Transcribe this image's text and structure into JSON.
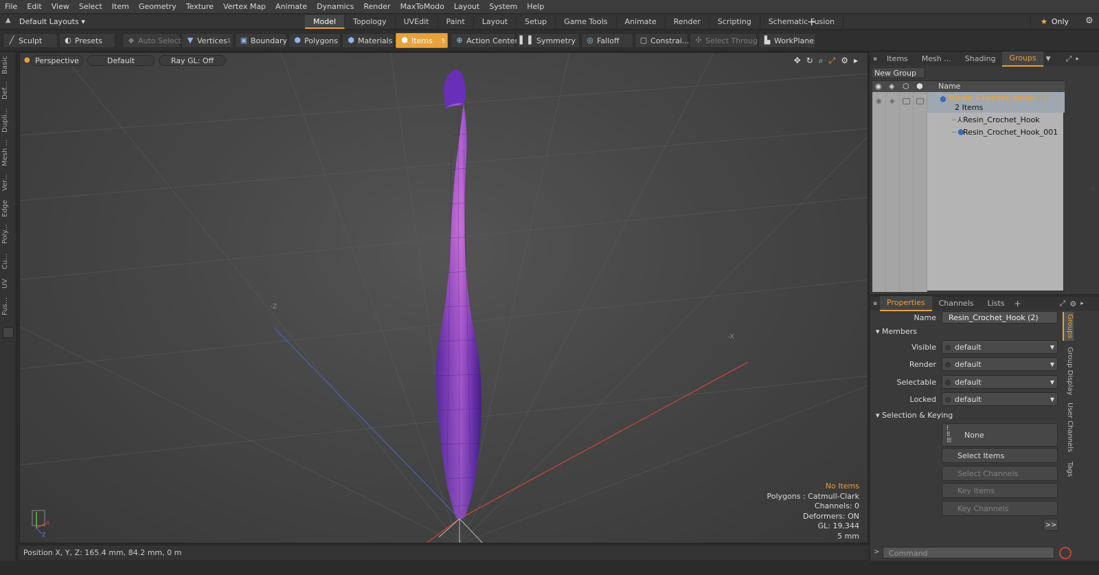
{
  "menubar": [
    "File",
    "Edit",
    "View",
    "Select",
    "Item",
    "Geometry",
    "Texture",
    "Vertex Map",
    "Animate",
    "Dynamics",
    "Render",
    "MaxToModo",
    "Layout",
    "System",
    "Help"
  ],
  "layout": {
    "selector": "Default Layouts",
    "tabs": [
      "Model",
      "Topology",
      "UVEdit",
      "Paint",
      "Layout",
      "Setup",
      "Game Tools",
      "Animate",
      "Render",
      "Scripting",
      "Schematic Fusion"
    ],
    "active_tab": "Model",
    "only_label": "Only"
  },
  "toolbar": {
    "sculpt": "Sculpt",
    "presets": "Presets",
    "auto_select": "Auto Select",
    "vertices": "Vertices",
    "vertices_count": "1",
    "boundary": "Boundary",
    "polygons": "Polygons",
    "materials": "Materials",
    "items": "Items",
    "items_count": "5",
    "action_center": "Action Center",
    "symmetry": "Symmetry",
    "falloff": "Falloff",
    "constrain": "Constrai...",
    "select_through": "Select Through",
    "workplane": "WorkPlane"
  },
  "left_tabs": [
    "Basic",
    "Def...",
    "Dupli...",
    "Mesh ...",
    "Ver...",
    "Edge",
    "Poly...",
    "Cu...",
    "UV",
    "Fus..."
  ],
  "viewport": {
    "view": "Perspective",
    "shading": "Default",
    "raygl": "Ray GL: Off",
    "axis_z_label": "-Z",
    "axis_x_label": "-X",
    "info": {
      "selection": "No Items",
      "polygons": "Polygons : Catmull-Clark",
      "channels": "Channels: 0",
      "deformers": "Deformers: ON",
      "gl": "GL: 19,344",
      "scale": "5 mm"
    }
  },
  "status": {
    "position": "Position X, Y, Z:  165.4 mm, 84.2 mm, 0 m"
  },
  "groups_panel": {
    "tabs": [
      "Items",
      "Mesh ...",
      "Shading",
      "Groups"
    ],
    "active_tab": "Groups",
    "new_group": "New Group",
    "col_name": "Name",
    "group_name": "Resin_Crochet_Hook",
    "group_suffix": "(2) : ...",
    "group_count": "2 Items",
    "children": [
      "Resin_Crochet_Hook",
      "Resin_Crochet_Hook_001"
    ]
  },
  "properties": {
    "tabs": [
      "Properties",
      "Channels",
      "Lists"
    ],
    "name_label": "Name",
    "name_value": "Resin_Crochet_Hook (2)",
    "members_title": "Members",
    "fields": [
      {
        "label": "Visible",
        "value": "default"
      },
      {
        "label": "Render",
        "value": "default"
      },
      {
        "label": "Selectable",
        "value": "default"
      },
      {
        "label": "Locked",
        "value": "default"
      }
    ],
    "selection_title": "Selection & Keying",
    "none_label": "None",
    "select_items": "Select Items",
    "select_channels": "Select Channels",
    "key_items": "Key Items",
    "key_channels": "Key Channels",
    "more": ">>",
    "side_tabs": [
      "Groups",
      "Group Display",
      "User Channels",
      "Tags"
    ],
    "command_placeholder": "Command"
  }
}
